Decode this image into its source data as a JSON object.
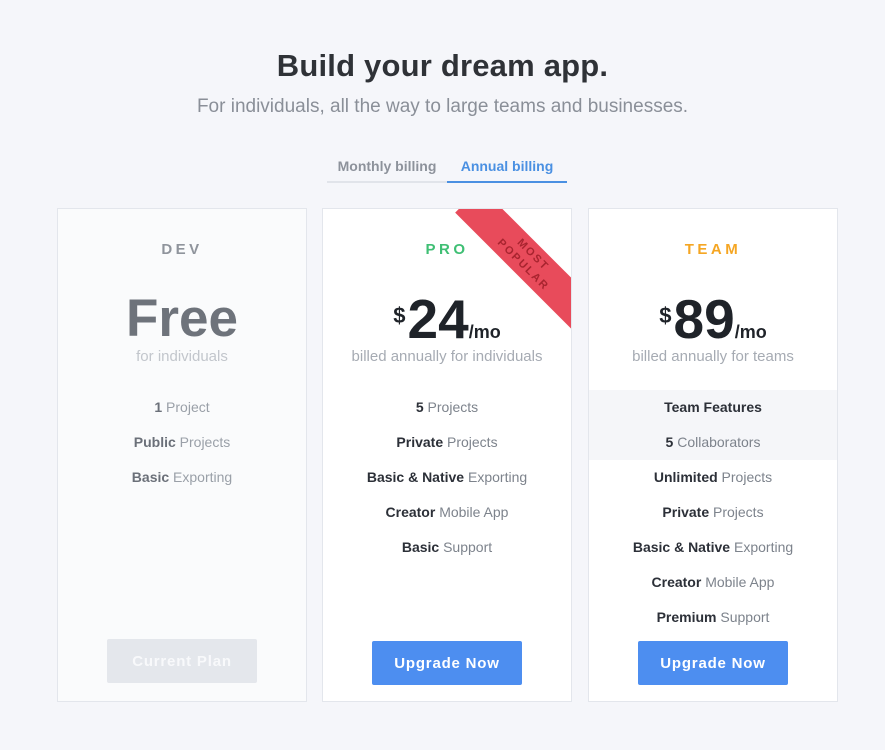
{
  "header": {
    "title": "Build your dream app.",
    "subtitle": "For individuals, all the way to large teams and businesses."
  },
  "billing": {
    "tabs": [
      {
        "label": "Monthly billing",
        "active": false
      },
      {
        "label": "Annual billing",
        "active": true
      }
    ]
  },
  "plans": {
    "dev": {
      "name": "DEV",
      "price": "Free",
      "note": "for individuals",
      "features": [
        {
          "strong": "1",
          "muted": " Project"
        },
        {
          "strong": "Public",
          "muted": " Projects"
        },
        {
          "strong": "Basic",
          "muted": " Exporting"
        }
      ],
      "button": "Current Plan"
    },
    "pro": {
      "name": "PRO",
      "currency": "$",
      "amount": "24",
      "period": "/mo",
      "note": "billed annually for individuals",
      "ribbon_line1": "MOST",
      "ribbon_line2": "POPULAR",
      "features": [
        {
          "strong": "5",
          "muted": " Projects"
        },
        {
          "strong": "Private",
          "muted": " Projects"
        },
        {
          "strong": "Basic & Native",
          "muted": " Exporting"
        },
        {
          "strong": "Creator",
          "muted": " Mobile App"
        },
        {
          "strong": "Basic",
          "muted": " Support"
        }
      ],
      "button": "Upgrade Now"
    },
    "team": {
      "name": "TEAM",
      "currency": "$",
      "amount": "89",
      "period": "/mo",
      "note": "billed annually for teams",
      "features": [
        {
          "strong": "Team Features",
          "muted": ""
        },
        {
          "strong": "5",
          "muted": " Collaborators"
        },
        {
          "strong": "Unlimited",
          "muted": " Projects"
        },
        {
          "strong": "Private",
          "muted": " Projects"
        },
        {
          "strong": "Basic & Native",
          "muted": " Exporting"
        },
        {
          "strong": "Creator",
          "muted": " Mobile App"
        },
        {
          "strong": "Premium",
          "muted": " Support"
        }
      ],
      "button": "Upgrade Now"
    }
  },
  "colors": {
    "accent": "#4a90e2",
    "button": "#4d8ef0",
    "pro": "#3fbf74",
    "team": "#f5a623",
    "ribbon": "#e84b5b"
  }
}
